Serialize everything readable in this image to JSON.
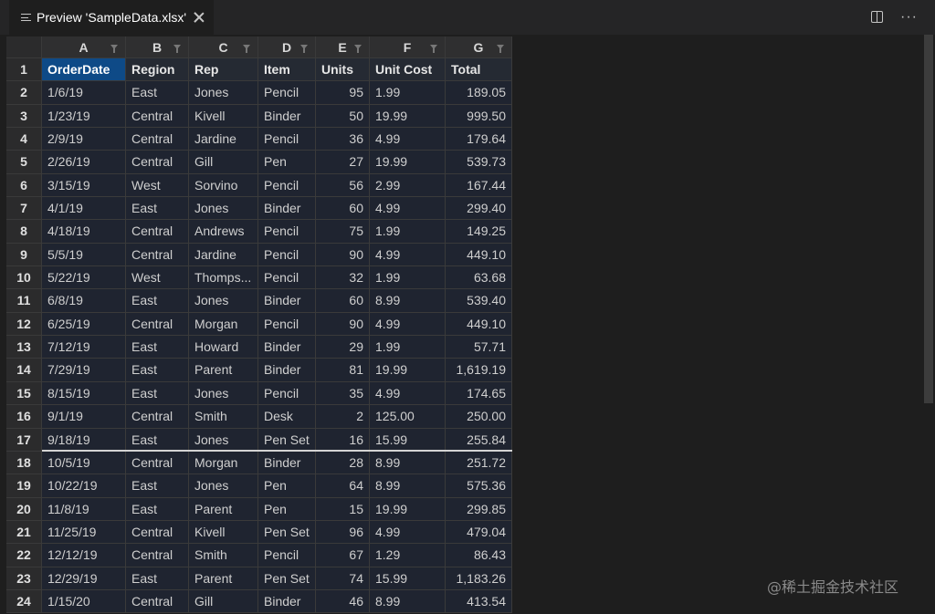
{
  "tab": {
    "title": "Preview 'SampleData.xlsx'"
  },
  "icons": {
    "tab": "list-icon",
    "split": "split-editor-icon",
    "more": "more-actions-icon"
  },
  "columns": [
    "A",
    "B",
    "C",
    "D",
    "E",
    "F",
    "G"
  ],
  "headers": [
    "OrderDate",
    "Region",
    "Rep",
    "Item",
    "Units",
    "Unit Cost",
    "Total"
  ],
  "rows": [
    [
      "1/6/19",
      "East",
      "Jones",
      "Pencil",
      "95",
      "1.99",
      "189.05"
    ],
    [
      "1/23/19",
      "Central",
      "Kivell",
      "Binder",
      "50",
      "19.99",
      "999.50"
    ],
    [
      "2/9/19",
      "Central",
      "Jardine",
      "Pencil",
      "36",
      "4.99",
      "179.64"
    ],
    [
      "2/26/19",
      "Central",
      "Gill",
      "Pen",
      "27",
      "19.99",
      "539.73"
    ],
    [
      "3/15/19",
      "West",
      "Sorvino",
      "Pencil",
      "56",
      "2.99",
      "167.44"
    ],
    [
      "4/1/19",
      "East",
      "Jones",
      "Binder",
      "60",
      "4.99",
      "299.40"
    ],
    [
      "4/18/19",
      "Central",
      "Andrews",
      "Pencil",
      "75",
      "1.99",
      "149.25"
    ],
    [
      "5/5/19",
      "Central",
      "Jardine",
      "Pencil",
      "90",
      "4.99",
      "449.10"
    ],
    [
      "5/22/19",
      "West",
      "Thomps...",
      "Pencil",
      "32",
      "1.99",
      "63.68"
    ],
    [
      "6/8/19",
      "East",
      "Jones",
      "Binder",
      "60",
      "8.99",
      "539.40"
    ],
    [
      "6/25/19",
      "Central",
      "Morgan",
      "Pencil",
      "90",
      "4.99",
      "449.10"
    ],
    [
      "7/12/19",
      "East",
      "Howard",
      "Binder",
      "29",
      "1.99",
      "57.71"
    ],
    [
      "7/29/19",
      "East",
      "Parent",
      "Binder",
      "81",
      "19.99",
      "1,619.19"
    ],
    [
      "8/15/19",
      "East",
      "Jones",
      "Pencil",
      "35",
      "4.99",
      "174.65"
    ],
    [
      "9/1/19",
      "Central",
      "Smith",
      "Desk",
      "2",
      "125.00",
      "250.00"
    ],
    [
      "9/18/19",
      "East",
      "Jones",
      "Pen Set",
      "16",
      "15.99",
      "255.84"
    ],
    [
      "10/5/19",
      "Central",
      "Morgan",
      "Binder",
      "28",
      "8.99",
      "251.72"
    ],
    [
      "10/22/19",
      "East",
      "Jones",
      "Pen",
      "64",
      "8.99",
      "575.36"
    ],
    [
      "11/8/19",
      "East",
      "Parent",
      "Pen",
      "15",
      "19.99",
      "299.85"
    ],
    [
      "11/25/19",
      "Central",
      "Kivell",
      "Pen Set",
      "96",
      "4.99",
      "479.04"
    ],
    [
      "12/12/19",
      "Central",
      "Smith",
      "Pencil",
      "67",
      "1.29",
      "86.43"
    ],
    [
      "12/29/19",
      "East",
      "Parent",
      "Pen Set",
      "74",
      "15.99",
      "1,183.26"
    ],
    [
      "1/15/20",
      "Central",
      "Gill",
      "Binder",
      "46",
      "8.99",
      "413.54"
    ]
  ],
  "watermark": "@稀土掘金技术社区"
}
